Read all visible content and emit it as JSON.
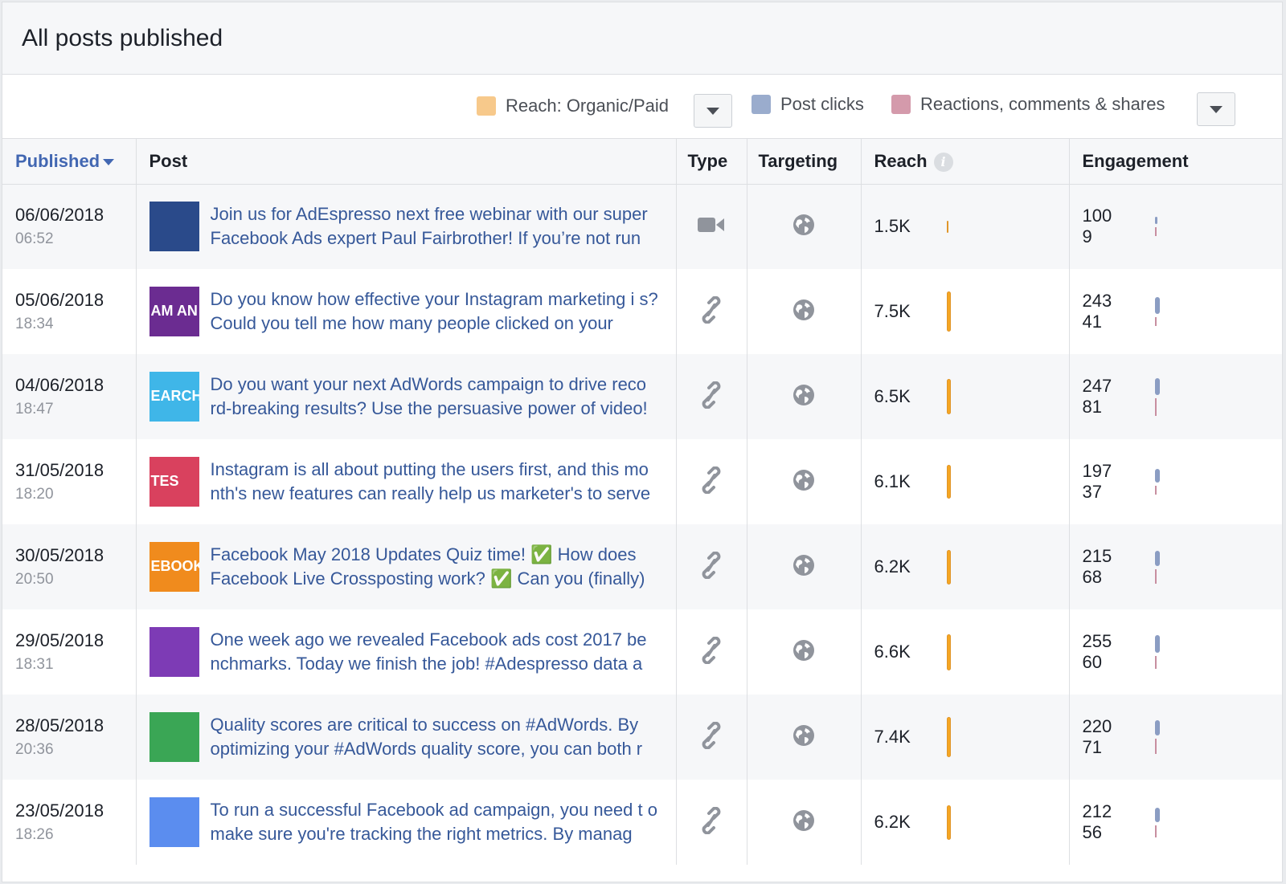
{
  "header": {
    "title": "All posts published"
  },
  "legend": {
    "reach_label": "Reach: Organic/Paid",
    "clicks_label": "Post clicks",
    "reactions_label": "Reactions, comments & shares",
    "reach_color": "#f7c98b",
    "clicks_color": "#9aaccd",
    "reactions_color": "#d49aab"
  },
  "columns": {
    "published": "Published",
    "post": "Post",
    "type": "Type",
    "targeting": "Targeting",
    "reach": "Reach",
    "engagement": "Engagement"
  },
  "rows": [
    {
      "date": "06/06/2018",
      "time": "06:52",
      "text": "Join us for AdEspresso next free webinar with our super Facebook Ads expert Paul Fairbrother! If you’re not run",
      "type": "video-icon",
      "targeting": "globe-icon",
      "reach": "1.5K",
      "reach_fraction": 0.2,
      "clicks": "100",
      "reactions": "9",
      "thumb_color": "#2a4a8a",
      "thumb_text": ""
    },
    {
      "date": "05/06/2018",
      "time": "18:34",
      "text": "Do you know how effective your Instagram marketing i s? Could you tell me how many people clicked on your",
      "type": "link-icon",
      "targeting": "globe-icon",
      "reach": "7.5K",
      "reach_fraction": 1.0,
      "clicks": "243",
      "reactions": "41",
      "thumb_color": "#6b2c91",
      "thumb_text": "AM AN"
    },
    {
      "date": "04/06/2018",
      "time": "18:47",
      "text": "Do you want your next AdWords campaign to drive reco rd-breaking results? Use the persuasive power of video!",
      "type": "link-icon",
      "targeting": "globe-icon",
      "reach": "6.5K",
      "reach_fraction": 0.87,
      "clicks": "247",
      "reactions": "81",
      "thumb_color": "#3fb6e8",
      "thumb_text": "EARCH+"
    },
    {
      "date": "31/05/2018",
      "time": "18:20",
      "text": "Instagram is all about putting the users first, and this mo nth's new features can really help us marketer's to serve",
      "type": "link-icon",
      "targeting": "globe-icon",
      "reach": "6.1K",
      "reach_fraction": 0.81,
      "clicks": "197",
      "reactions": "37",
      "thumb_color": "#d9415e",
      "thumb_text": "TES"
    },
    {
      "date": "30/05/2018",
      "time": "20:50",
      "text": "Facebook May 2018 Updates Quiz time! ✅  How does Facebook Live Crossposting work? ✅  Can you (finally)",
      "type": "link-icon",
      "targeting": "globe-icon",
      "reach": "6.2K",
      "reach_fraction": 0.83,
      "clicks": "215",
      "reactions": "68",
      "thumb_color": "#f08b1d",
      "thumb_text": "EBOOK"
    },
    {
      "date": "29/05/2018",
      "time": "18:31",
      "text": "One week ago we revealed Facebook ads cost 2017 be nchmarks. Today we finish the job! #Adespresso data a",
      "type": "link-icon",
      "targeting": "globe-icon",
      "reach": "6.6K",
      "reach_fraction": 0.88,
      "clicks": "255",
      "reactions": "60",
      "thumb_color": "#7d3bb5",
      "thumb_text": ""
    },
    {
      "date": "28/05/2018",
      "time": "20:36",
      "text": "Quality scores are critical to success on #AdWords. By optimizing your #AdWords quality score, you can both r",
      "type": "link-icon",
      "targeting": "globe-icon",
      "reach": "7.4K",
      "reach_fraction": 0.99,
      "clicks": "220",
      "reactions": "71",
      "thumb_color": "#3aa655",
      "thumb_text": ""
    },
    {
      "date": "23/05/2018",
      "time": "18:26",
      "text": "To run a successful Facebook ad campaign, you need t o make sure you're tracking the right metrics. By manag",
      "type": "link-icon",
      "targeting": "globe-icon",
      "reach": "6.2K",
      "reach_fraction": 0.83,
      "clicks": "212",
      "reactions": "56",
      "thumb_color": "#5b8def",
      "thumb_text": ""
    }
  ]
}
